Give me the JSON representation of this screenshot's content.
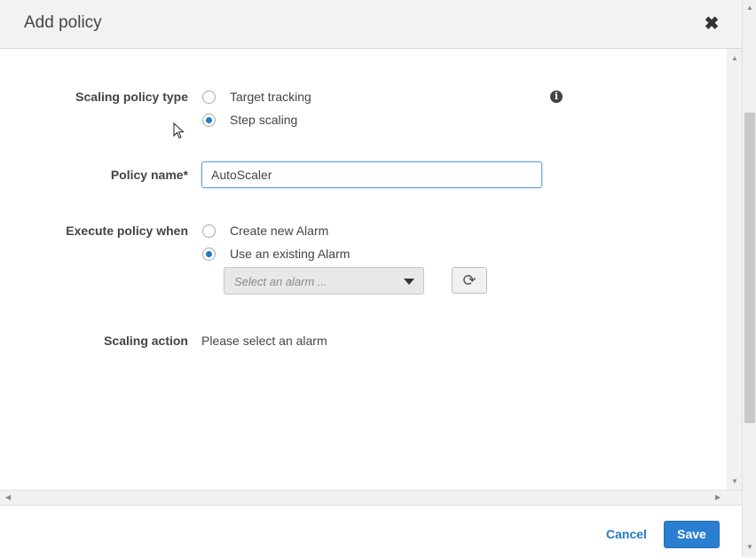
{
  "dialog": {
    "title": "Add policy",
    "close_icon": "close-icon"
  },
  "form": {
    "scaling_policy_type": {
      "label": "Scaling policy type",
      "options": [
        {
          "label": "Target tracking",
          "selected": false
        },
        {
          "label": "Step scaling",
          "selected": true
        }
      ],
      "info_icon": "info-icon"
    },
    "policy_name": {
      "label": "Policy name*",
      "value": "AutoScaler"
    },
    "execute_policy_when": {
      "label": "Execute policy when",
      "options": [
        {
          "label": "Create new Alarm",
          "selected": false
        },
        {
          "label": "Use an existing Alarm",
          "selected": true
        }
      ],
      "alarm_select_placeholder": "Select an alarm ...",
      "refresh_icon": "refresh-icon"
    },
    "scaling_action": {
      "label": "Scaling action",
      "value": "Please select an alarm"
    }
  },
  "footer": {
    "cancel_label": "Cancel",
    "save_label": "Save"
  },
  "colors": {
    "accent": "#2478c6",
    "save_button": "#2b7fd0",
    "header_bg": "#f2f2f2"
  }
}
